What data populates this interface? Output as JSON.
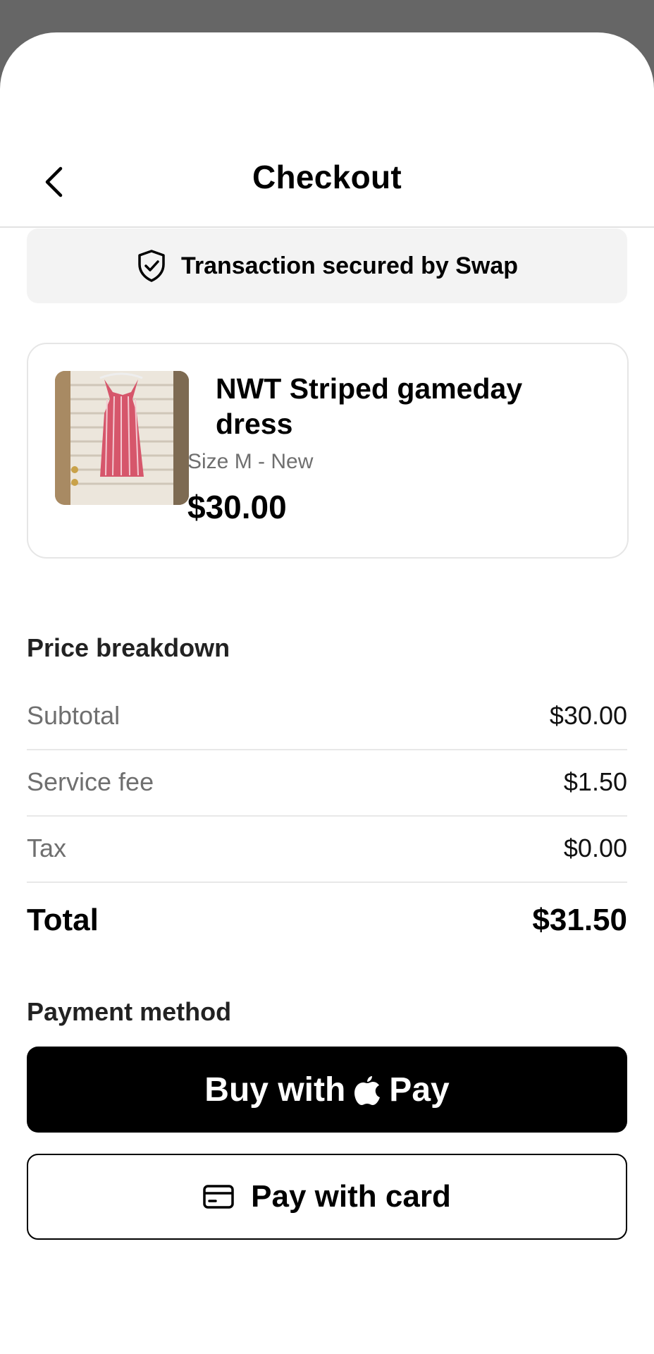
{
  "header": {
    "title": "Checkout",
    "back_icon": "chevron-left-icon"
  },
  "banner": {
    "text": "Transaction secured by Swap",
    "icon": "shield-check-icon"
  },
  "item": {
    "title": "NWT Striped gameday dress",
    "meta": "Size M - New",
    "price": "$30.00",
    "image": "dress-photo"
  },
  "price_breakdown": {
    "title": "Price breakdown",
    "rows": [
      {
        "label": "Subtotal",
        "value": "$30.00"
      },
      {
        "label": "Service fee",
        "value": "$1.50"
      },
      {
        "label": "Tax",
        "value": "$0.00"
      }
    ],
    "total_label": "Total",
    "total_value": "$31.50"
  },
  "payment": {
    "title": "Payment method",
    "apple_pay_prefix": "Buy with",
    "apple_pay_suffix": "Pay",
    "card_label": "Pay with card",
    "card_icon": "credit-card-icon"
  },
  "colors": {
    "background_overlay": "#666666",
    "muted_text": "#6f6f6f",
    "banner_bg": "#f3f3f3"
  }
}
